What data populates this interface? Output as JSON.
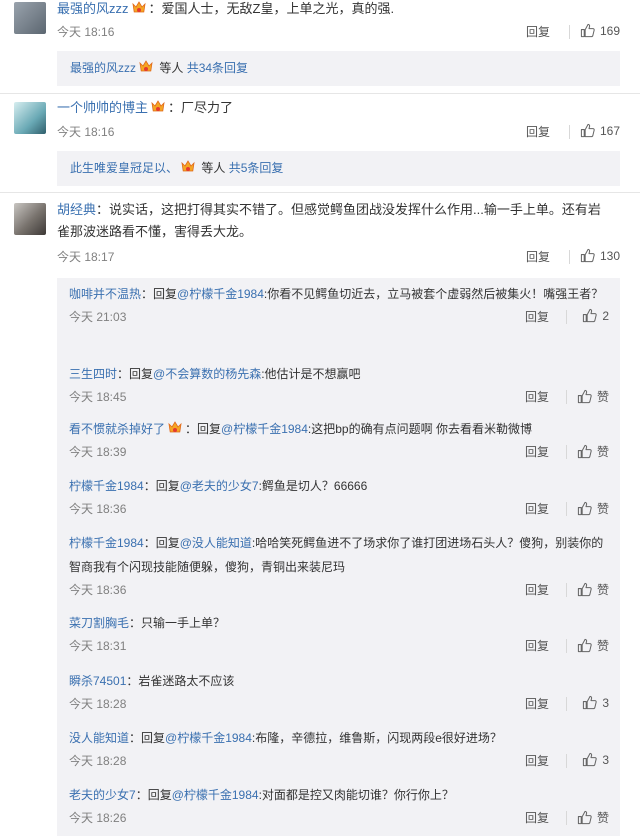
{
  "comments": [
    {
      "username": "最强的风zzz",
      "text": "：爱国人士，无敌Z皇，上单之光，真的强.",
      "time": "今天 18:16",
      "reply_label": "回复",
      "likes": "169",
      "summary": {
        "user": "最强的风zzz",
        "rest": " 等人 ",
        "count_text": "共34条回复"
      }
    },
    {
      "username": "一个帅帅的博主",
      "text": "：厂尽力了",
      "time": "今天 18:16",
      "reply_label": "回复",
      "likes": "167",
      "summary": {
        "user": "此生唯爱皇冠足以、",
        "rest": " 等人 ",
        "count_text": "共5条回复"
      }
    },
    {
      "username": "胡经典",
      "text": "：说实话，这把打得其实不错了。但感觉鳄鱼团战没发挥什么作用...输一手上单。还有岩雀那波迷路看不懂，害得丢大龙。",
      "time": "今天 18:17",
      "reply_label": "回复",
      "likes": "130"
    }
  ],
  "replies": [
    {
      "user": "咖啡并不温热",
      "prefix": "：回复",
      "target": "@柠檬千金1984",
      "text": ":你看不见鳄鱼切近去，立马被套个虚弱然后被集火！嘴强王者？",
      "time": "今天 21:03",
      "reply_label": "回复",
      "likes": "2"
    },
    {
      "user": "三生四时",
      "prefix": "：回复",
      "target": "@不会算数的杨先森",
      "text": ":他估计是不想赢吧",
      "time": "今天 18:45",
      "reply_label": "回复",
      "likes": "赞"
    },
    {
      "user": "看不惯就杀掉好了",
      "prefix": "：回复",
      "target": "@柠檬千金1984",
      "text": ":这把bp的确有点问题啊 你去看看米勒微博",
      "time": "今天 18:39",
      "reply_label": "回复",
      "likes": "赞",
      "badge": true
    },
    {
      "user": "柠檬千金1984",
      "prefix": "：回复",
      "target": "@老夫的少女7",
      "text": ":鳄鱼是切人？66666",
      "time": "今天 18:36",
      "reply_label": "回复",
      "likes": "赞"
    },
    {
      "user": "柠檬千金1984",
      "prefix": "：回复",
      "target": "@没人能知道",
      "text": ":哈哈笑死鳄鱼进不了场求你了谁打团进场石头人？傻狗，别装你的智商我有个闪现技能随便躲，傻狗，青铜出来装尼玛",
      "time": "今天 18:36",
      "reply_label": "回复",
      "likes": "赞"
    },
    {
      "user": "菜刀割胸毛",
      "prefix": "：只输一手上单？",
      "target": "",
      "text": "",
      "time": "今天 18:31",
      "reply_label": "回复",
      "likes": "赞"
    },
    {
      "user": "瞬杀74501",
      "prefix": "：岩雀迷路太不应该",
      "target": "",
      "text": "",
      "time": "今天 18:28",
      "reply_label": "回复",
      "likes": "3"
    },
    {
      "user": "没人能知道",
      "prefix": "：回复",
      "target": "@柠檬千金1984",
      "text": ":布隆，辛德拉，维鲁斯，闪现两段e很好进场？",
      "time": "今天 18:28",
      "reply_label": "回复",
      "likes": "3"
    },
    {
      "user": "老夫的少女7",
      "prefix": "：回复",
      "target": "@柠檬千金1984",
      "text": ":对面都是控又肉能切谁？你行你上？",
      "time": "今天 18:26",
      "reply_label": "回复",
      "likes": "赞"
    }
  ],
  "colors": {
    "link": "#3a70b0",
    "panel": "#f2f2f5",
    "text": "#333333",
    "muted": "#808080"
  }
}
